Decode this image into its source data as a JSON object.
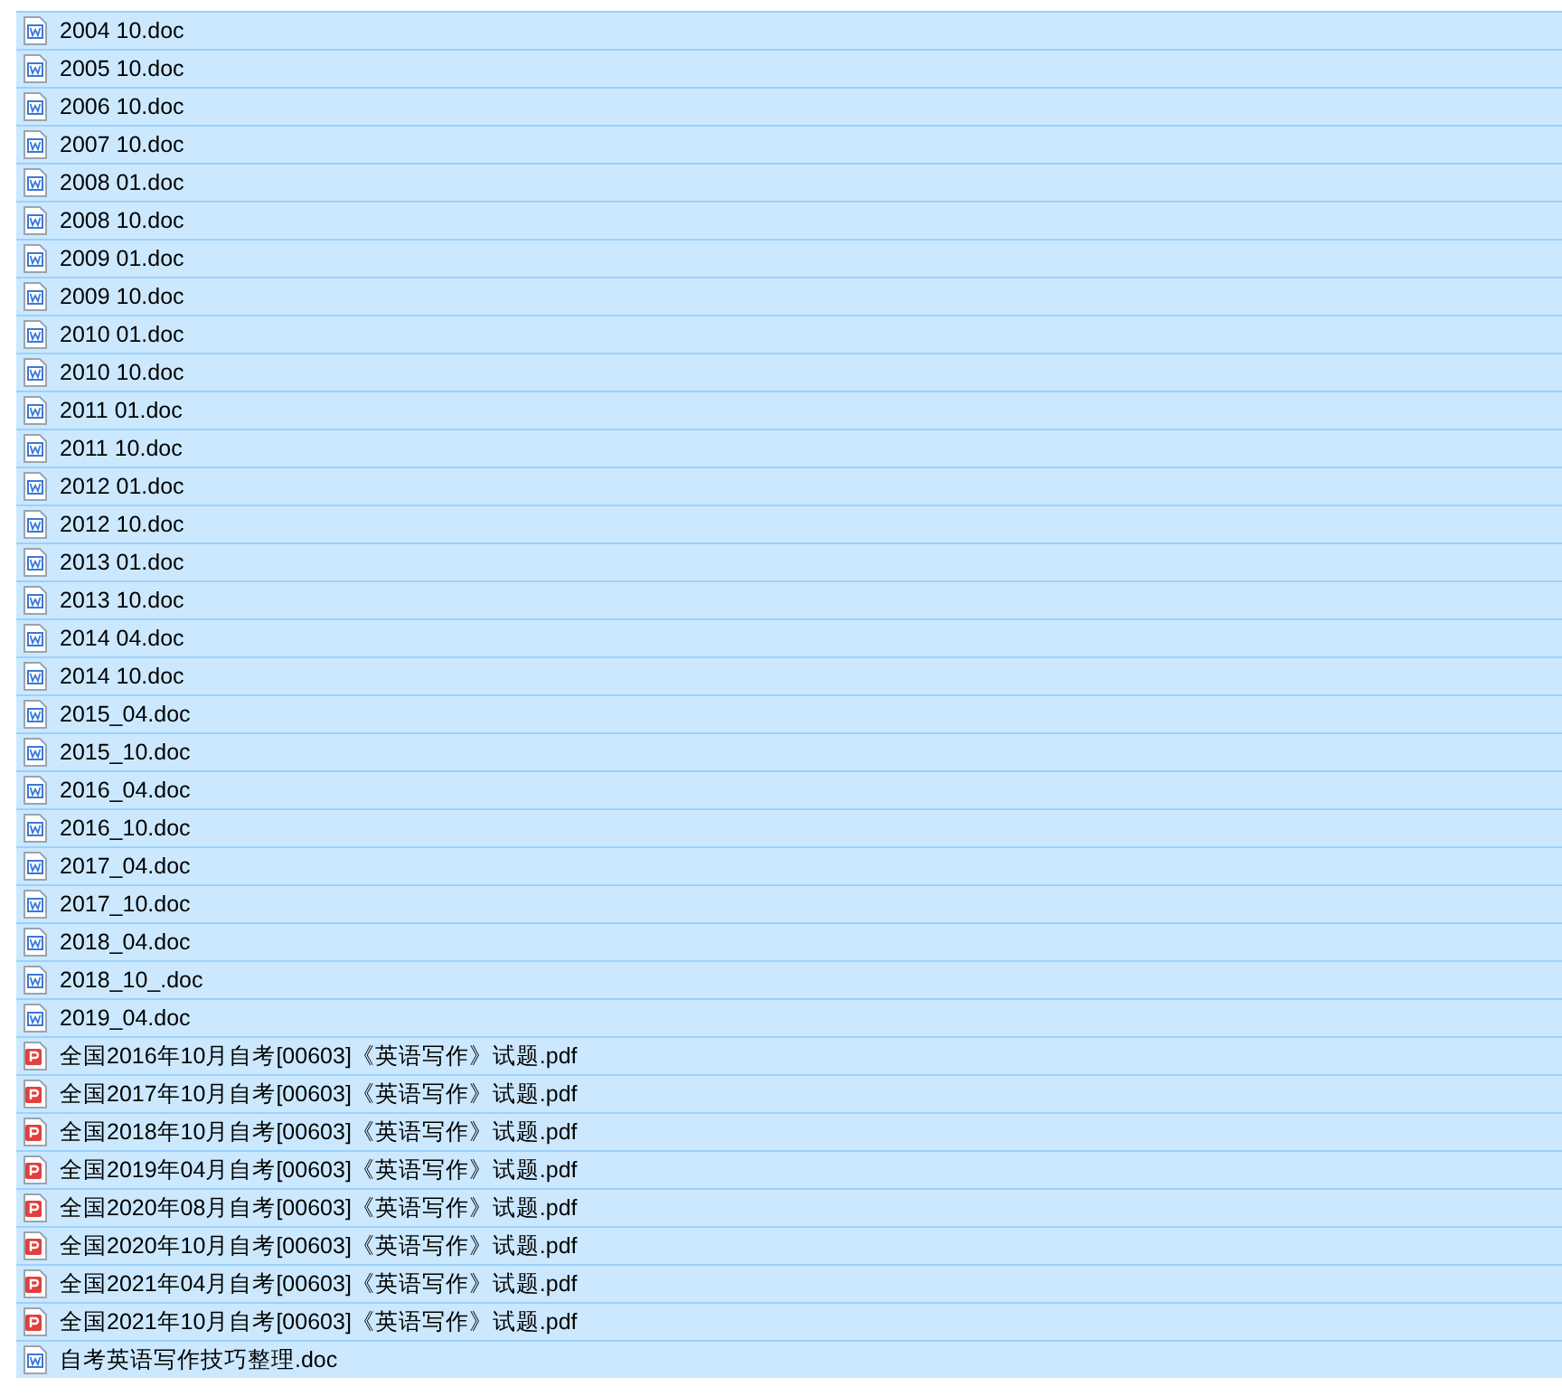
{
  "files": [
    {
      "name": "2004 10.doc",
      "kind": "doc",
      "selected": true
    },
    {
      "name": "2005 10.doc",
      "kind": "doc",
      "selected": true
    },
    {
      "name": "2006 10.doc",
      "kind": "doc",
      "selected": true
    },
    {
      "name": "2007 10.doc",
      "kind": "doc",
      "selected": true
    },
    {
      "name": "2008 01.doc",
      "kind": "doc",
      "selected": true
    },
    {
      "name": "2008 10.doc",
      "kind": "doc",
      "selected": true
    },
    {
      "name": "2009 01.doc",
      "kind": "doc",
      "selected": true
    },
    {
      "name": "2009 10.doc",
      "kind": "doc",
      "selected": true
    },
    {
      "name": "2010 01.doc",
      "kind": "doc",
      "selected": true
    },
    {
      "name": "2010 10.doc",
      "kind": "doc",
      "selected": true
    },
    {
      "name": "2011 01.doc",
      "kind": "doc",
      "selected": true
    },
    {
      "name": "2011 10.doc",
      "kind": "doc",
      "selected": true
    },
    {
      "name": "2012 01.doc",
      "kind": "doc",
      "selected": true
    },
    {
      "name": "2012 10.doc",
      "kind": "doc",
      "selected": true
    },
    {
      "name": "2013 01.doc",
      "kind": "doc",
      "selected": true
    },
    {
      "name": "2013 10.doc",
      "kind": "doc",
      "selected": true
    },
    {
      "name": "2014 04.doc",
      "kind": "doc",
      "selected": true
    },
    {
      "name": "2014 10.doc",
      "kind": "doc",
      "selected": true
    },
    {
      "name": "2015_04.doc",
      "kind": "doc",
      "selected": true
    },
    {
      "name": "2015_10.doc",
      "kind": "doc",
      "selected": true
    },
    {
      "name": "2016_04.doc",
      "kind": "doc",
      "selected": true
    },
    {
      "name": "2016_10.doc",
      "kind": "doc",
      "selected": true
    },
    {
      "name": "2017_04.doc",
      "kind": "doc",
      "selected": true
    },
    {
      "name": "2017_10.doc",
      "kind": "doc",
      "selected": true
    },
    {
      "name": "2018_04.doc",
      "kind": "doc",
      "selected": true
    },
    {
      "name": "2018_10_.doc",
      "kind": "doc",
      "selected": true
    },
    {
      "name": "2019_04.doc",
      "kind": "doc",
      "selected": true
    },
    {
      "name": "全国2016年10月自考[00603]《英语写作》试题.pdf",
      "kind": "pdf",
      "selected": true
    },
    {
      "name": "全国2017年10月自考[00603]《英语写作》试题.pdf",
      "kind": "pdf",
      "selected": true
    },
    {
      "name": "全国2018年10月自考[00603]《英语写作》试题.pdf",
      "kind": "pdf",
      "selected": true
    },
    {
      "name": "全国2019年04月自考[00603]《英语写作》试题.pdf",
      "kind": "pdf",
      "selected": true
    },
    {
      "name": "全国2020年08月自考[00603]《英语写作》试题.pdf",
      "kind": "pdf",
      "selected": true
    },
    {
      "name": "全国2020年10月自考[00603]《英语写作》试题.pdf",
      "kind": "pdf",
      "selected": true
    },
    {
      "name": "全国2021年04月自考[00603]《英语写作》试题.pdf",
      "kind": "pdf",
      "selected": true
    },
    {
      "name": "全国2021年10月自考[00603]《英语写作》试题.pdf",
      "kind": "pdf",
      "selected": true
    },
    {
      "name": "自考英语写作技巧整理.doc",
      "kind": "doc",
      "selected": true
    }
  ]
}
